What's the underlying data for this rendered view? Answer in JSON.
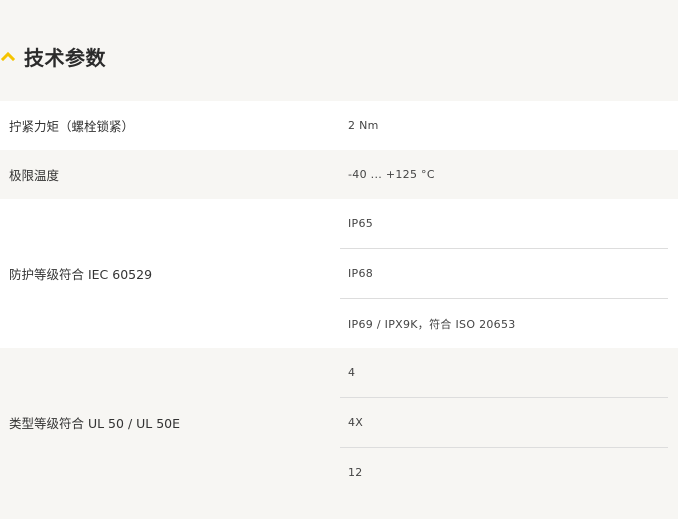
{
  "section": {
    "title": "技术参数",
    "chevron_icon": "chevron-up-icon",
    "accent_color": "#f5c400"
  },
  "rows": [
    {
      "label": "拧紧力矩（螺栓锁紧）",
      "values": [
        "2 Nm"
      ]
    },
    {
      "label": "极限温度",
      "values": [
        "-40 ... +125 °C"
      ]
    },
    {
      "label": "防护等级符合 IEC 60529",
      "values": [
        "IP65",
        "IP68",
        "IP69 / IPX9K，符合 ISO 20653"
      ]
    },
    {
      "label": "类型等级符合 UL 50 / UL 50E",
      "values": [
        "4",
        "4X",
        "12"
      ]
    }
  ]
}
